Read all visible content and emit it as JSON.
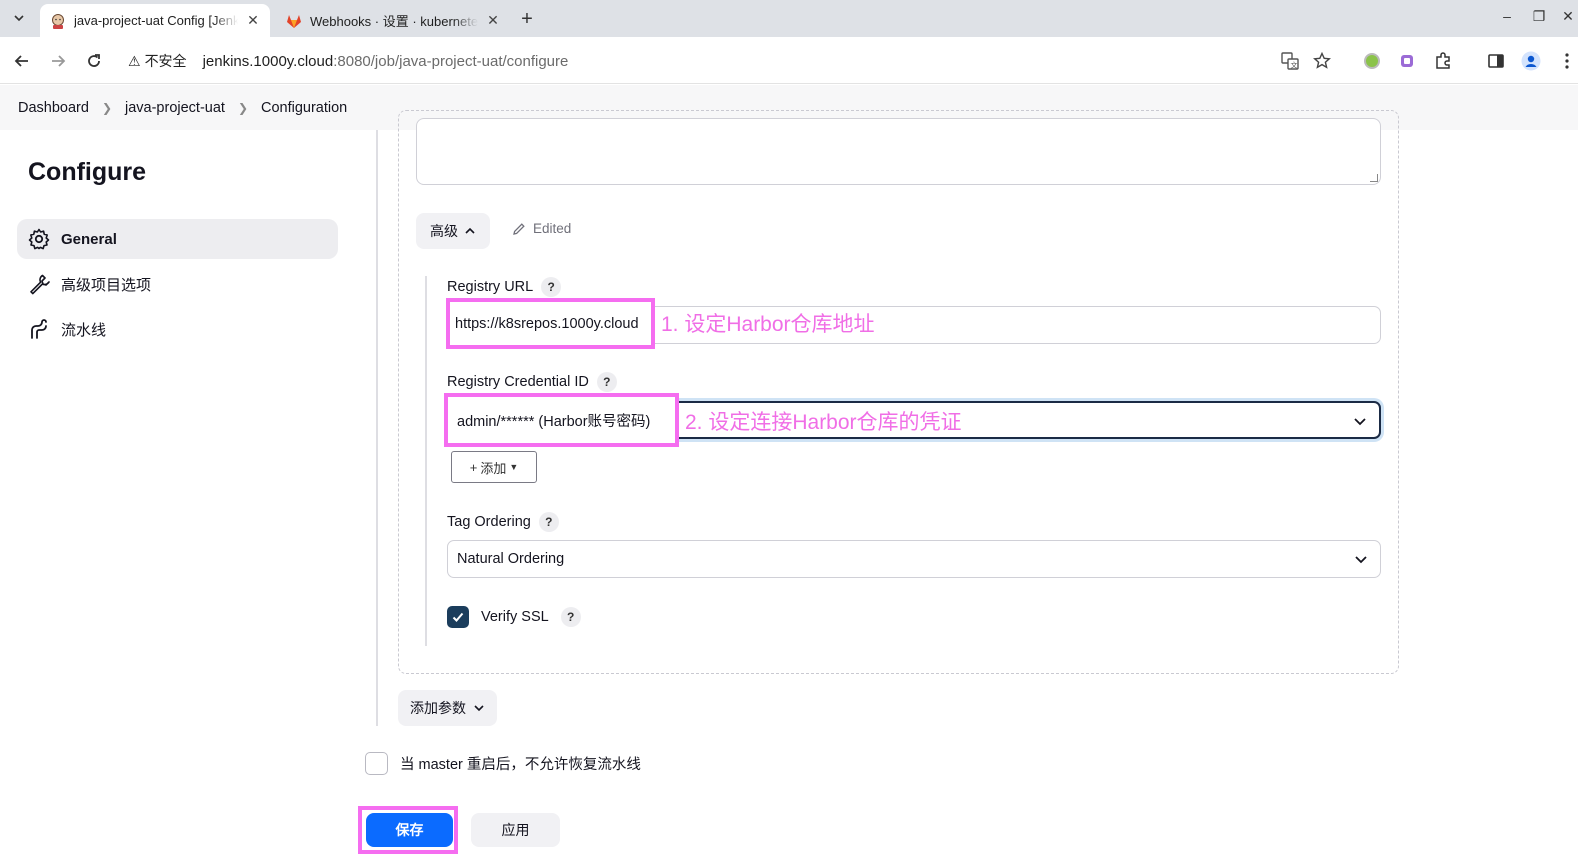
{
  "browser": {
    "tabs": [
      {
        "title": "java-project-uat Config [Jenkins]",
        "active": true
      },
      {
        "title": "Webhooks · 设置 · kubernetes",
        "active": false
      }
    ],
    "new_tab_label": "+",
    "address": {
      "security_label": "不安全",
      "host": "jenkins.1000y.cloud",
      "path": ":8080/job/java-project-uat/configure"
    }
  },
  "breadcrumbs": [
    "Dashboard",
    "java-project-uat",
    "Configuration"
  ],
  "sidebar": {
    "title": "Configure",
    "items": [
      {
        "label": "General",
        "icon": "gear-icon",
        "active": true
      },
      {
        "label": "高级项目选项",
        "icon": "wrench-icon",
        "active": false
      },
      {
        "label": "流水线",
        "icon": "pipeline-icon",
        "active": false
      }
    ]
  },
  "advanced": {
    "toggle_label": "高级",
    "edited_label": "Edited"
  },
  "fields": {
    "registry_url": {
      "label": "Registry URL",
      "value": "https://k8srepos.1000y.cloud"
    },
    "registry_credential": {
      "label": "Registry Credential ID",
      "value": "admin/****** (Harbor账号密码)"
    },
    "add_button_label": "添加",
    "tag_ordering": {
      "label": "Tag Ordering",
      "value": "Natural Ordering"
    },
    "verify_ssl": {
      "label": "Verify SSL",
      "checked": true
    },
    "help_label": "?"
  },
  "add_param_label": "添加参数",
  "resume_option": {
    "label": "当 master 重启后，不允许恢复流水线",
    "checked": false
  },
  "actions": {
    "save_label": "保存",
    "apply_label": "应用"
  },
  "annotations": {
    "step1": "1. 设定Harbor仓库地址",
    "step2": "2. 设定连接Harbor仓库的凭证",
    "highlight_color": "#f56df0"
  },
  "colors": {
    "primary": "#0b6bff",
    "checkbox": "#1b3d5c"
  }
}
